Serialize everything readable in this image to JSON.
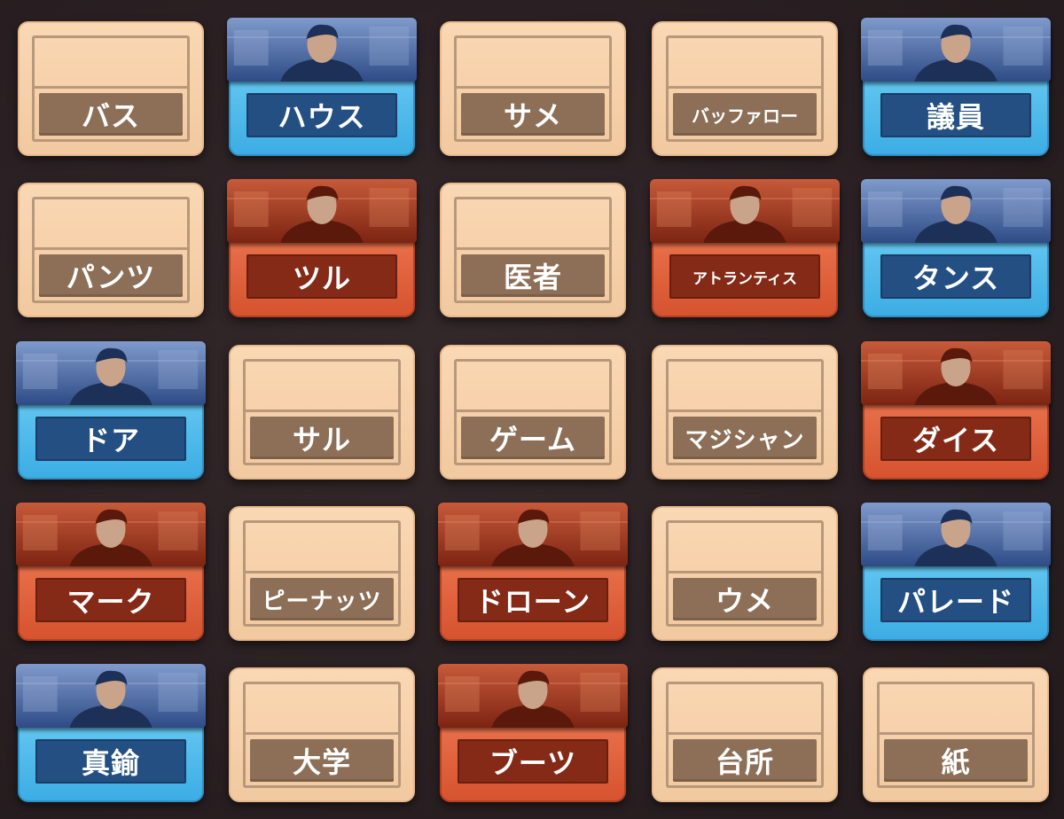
{
  "board": {
    "cards": [
      {
        "word": "バス",
        "team": "neutral"
      },
      {
        "word": "ハウス",
        "team": "blue"
      },
      {
        "word": "サメ",
        "team": "neutral"
      },
      {
        "word": "バッファロー",
        "team": "neutral"
      },
      {
        "word": "議員",
        "team": "blue"
      },
      {
        "word": "パンツ",
        "team": "neutral"
      },
      {
        "word": "ツル",
        "team": "red"
      },
      {
        "word": "医者",
        "team": "neutral"
      },
      {
        "word": "アトランティス",
        "team": "red"
      },
      {
        "word": "タンス",
        "team": "blue"
      },
      {
        "word": "ドア",
        "team": "blue"
      },
      {
        "word": "サル",
        "team": "neutral"
      },
      {
        "word": "ゲーム",
        "team": "neutral"
      },
      {
        "word": "マジシャン",
        "team": "neutral"
      },
      {
        "word": "ダイス",
        "team": "red"
      },
      {
        "word": "マーク",
        "team": "red"
      },
      {
        "word": "ピーナッツ",
        "team": "neutral"
      },
      {
        "word": "ドローン",
        "team": "red"
      },
      {
        "word": "ウメ",
        "team": "neutral"
      },
      {
        "word": "パレード",
        "team": "blue"
      },
      {
        "word": "真鍮",
        "team": "blue"
      },
      {
        "word": "大学",
        "team": "neutral"
      },
      {
        "word": "ブーツ",
        "team": "red"
      },
      {
        "word": "台所",
        "team": "neutral"
      },
      {
        "word": "紙",
        "team": "neutral"
      }
    ]
  },
  "colors": {
    "blue_team": "#3cade4",
    "red_team": "#d6532f",
    "neutral": "#f2c9a0"
  }
}
